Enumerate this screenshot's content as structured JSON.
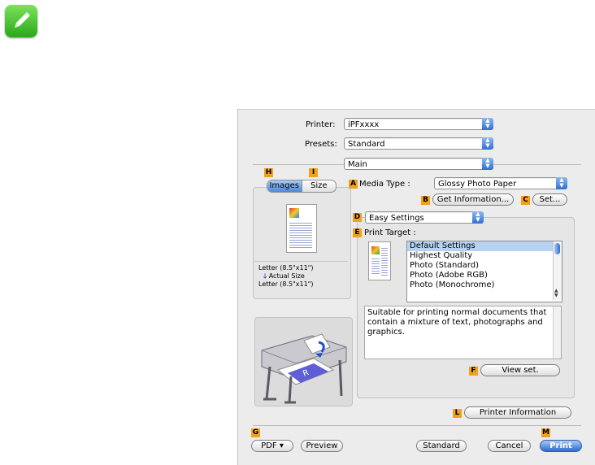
{
  "printer": {
    "label": "Printer:",
    "value": "iPFxxxx"
  },
  "presets": {
    "label": "Presets:",
    "value": "Standard"
  },
  "panel": {
    "value": "Main"
  },
  "tabs": {
    "images": "Images",
    "size": "Size"
  },
  "tags": {
    "A": "A",
    "B": "B",
    "C": "C",
    "D": "D",
    "E": "E",
    "F": "F",
    "G": "G",
    "H": "H",
    "I": "I",
    "L": "L",
    "M": "M"
  },
  "media_type": {
    "label": "Media Type :",
    "value": "Glossy Photo Paper"
  },
  "buttons": {
    "get_information": "Get Information...",
    "set": "Set...",
    "view_set": "View set.",
    "printer_information": "Printer Information",
    "pdf": "PDF ▾",
    "preview": "Preview",
    "standard": "Standard",
    "cancel": "Cancel",
    "print": "Print"
  },
  "settings_mode": {
    "value": "Easy Settings"
  },
  "print_target": {
    "label": "Print Target :",
    "items": [
      "Default Settings",
      "Highest Quality",
      "Photo (Standard)",
      "Photo (Adobe RGB)",
      "Photo (Monochrome)"
    ],
    "selected_index": 0
  },
  "description": "Suitable for printing normal documents that contain a mixture of text, photographs and graphics.",
  "preview_info": {
    "line1": "Letter (8.5\"x11\")",
    "line2": "Actual Size",
    "line3": "Letter (8.5\"x11\")"
  }
}
